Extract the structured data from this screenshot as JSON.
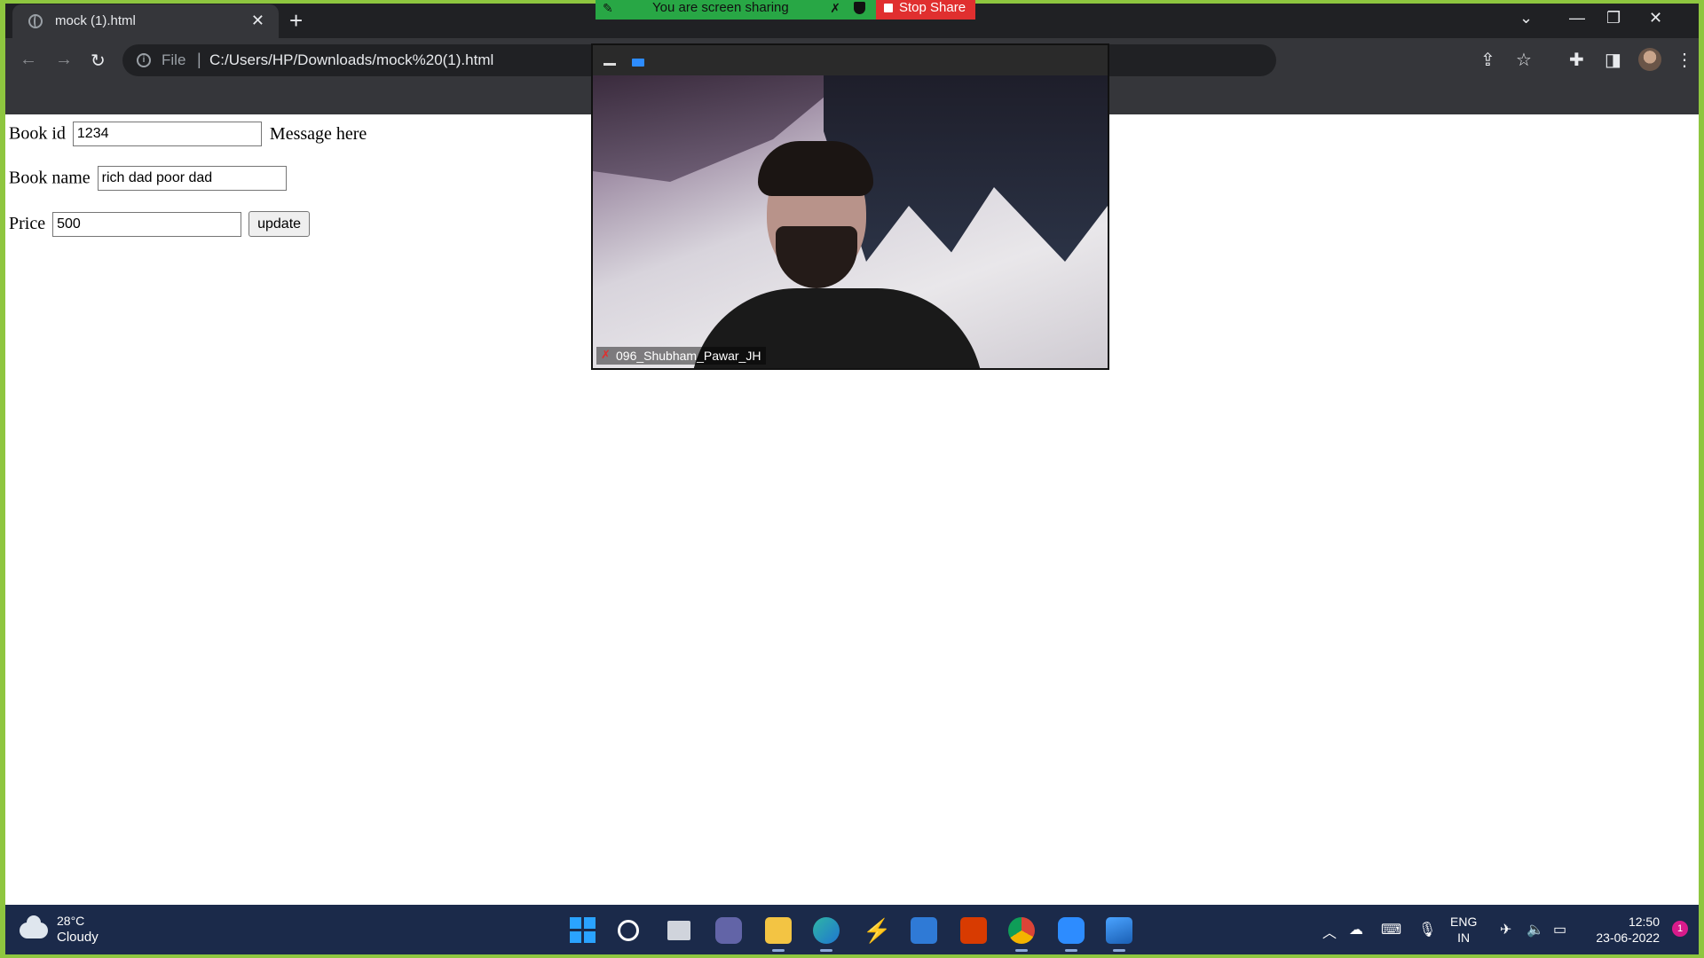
{
  "browser": {
    "tab_title": "mock (1).html",
    "address_scheme": "File",
    "address_url": "C:/Users/HP/Downloads/mock%20(1).html"
  },
  "share_banner": {
    "message": "You are screen sharing",
    "stop_label": "Stop Share",
    "accent": "#28a745",
    "stop_color": "#e02f2f"
  },
  "form": {
    "book_id_label": "Book id",
    "book_id_value": "1234",
    "message": "Message here",
    "book_name_label": "Book name",
    "book_name_value": "rich dad poor dad",
    "price_label": "Price",
    "price_value": "500",
    "update_label": "update"
  },
  "video": {
    "participant_name": "096_Shubham_Pawar_JH"
  },
  "taskbar": {
    "temperature": "28°C",
    "condition": "Cloudy",
    "lang_line1": "ENG",
    "lang_line2": "IN",
    "time": "12:50",
    "date": "23-06-2022",
    "notifications": "1"
  }
}
